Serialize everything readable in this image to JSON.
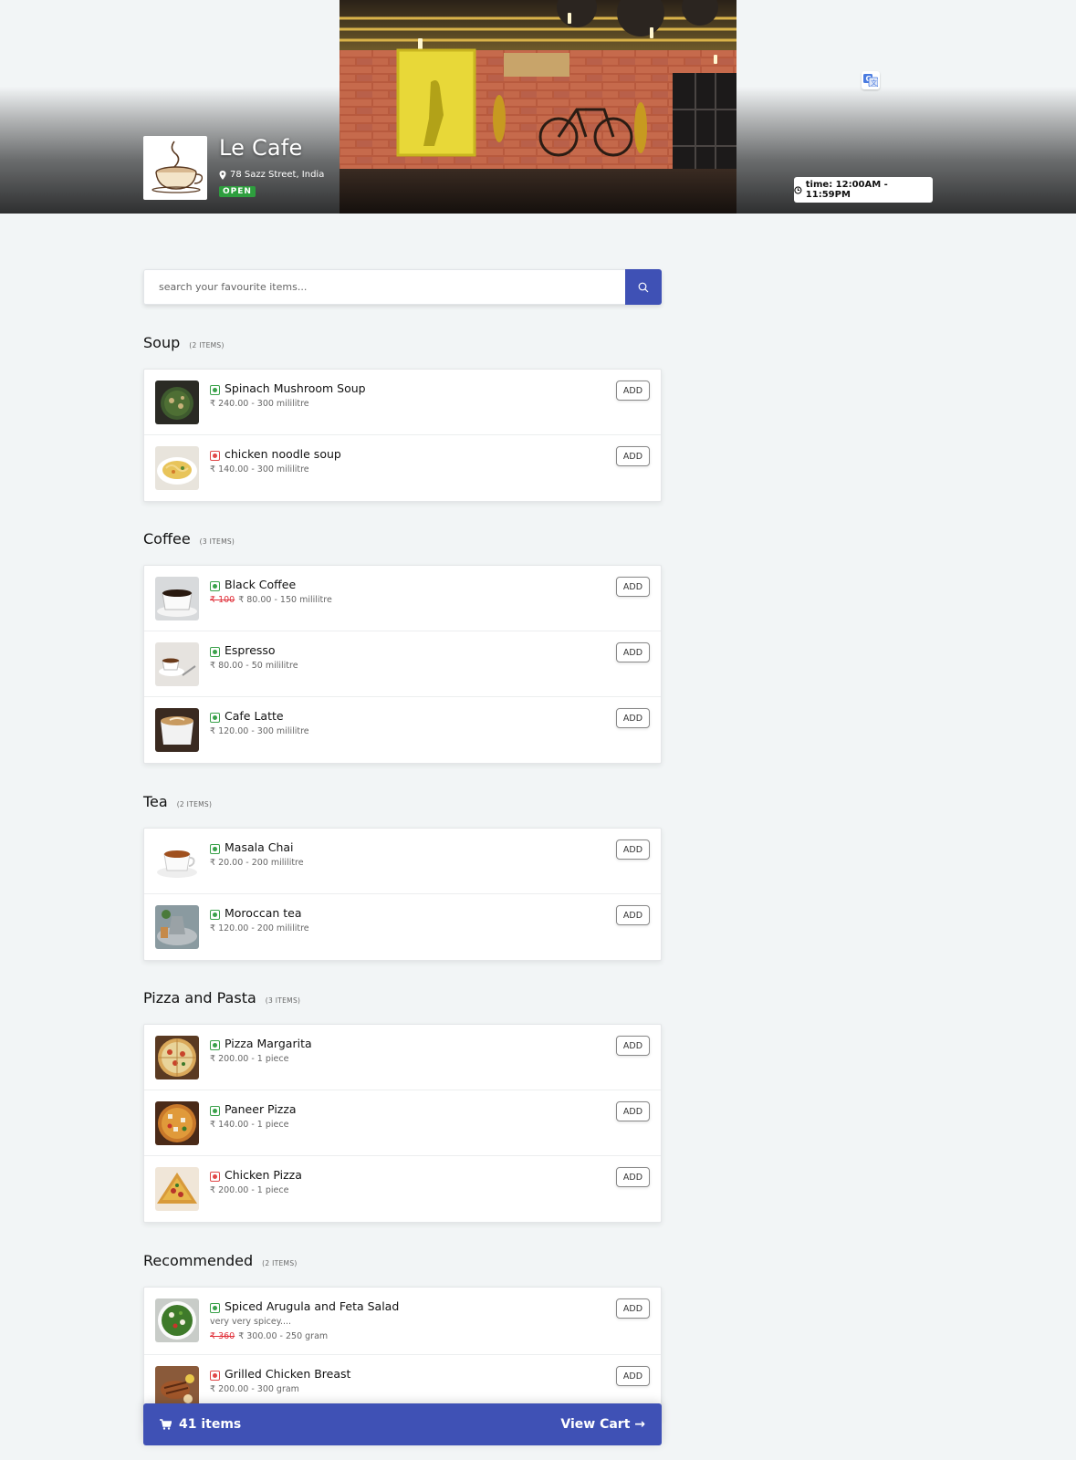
{
  "header": {
    "cafe_name": "Le Cafe",
    "address": "78 Sazz Street, India",
    "status": "OPEN",
    "time": "time: 12:00AM - 11:59PM",
    "logo_text": "LeCafe"
  },
  "search": {
    "placeholder": "search your favourite items..."
  },
  "categories": [
    {
      "title": "Soup",
      "count": "(2 ITEMS)",
      "items": [
        {
          "name": "Spinach Mushroom Soup",
          "type": "veg",
          "price": "₹ 240.00 - 300 mililitre",
          "add": "ADD"
        },
        {
          "name": "chicken noodle soup",
          "type": "nonveg",
          "price": "₹ 140.00 - 300 mililitre",
          "add": "ADD"
        }
      ]
    },
    {
      "title": "Coffee",
      "count": "(3 ITEMS)",
      "items": [
        {
          "name": "Black Coffee",
          "type": "veg",
          "old_price": "₹ 100",
          "price": "₹ 80.00 - 150 mililitre",
          "add": "ADD"
        },
        {
          "name": "Espresso",
          "type": "veg",
          "price": "₹ 80.00 - 50 mililitre",
          "add": "ADD"
        },
        {
          "name": "Cafe Latte",
          "type": "veg",
          "price": "₹ 120.00 - 300 mililitre",
          "add": "ADD"
        }
      ]
    },
    {
      "title": "Tea",
      "count": "(2 ITEMS)",
      "items": [
        {
          "name": "Masala Chai",
          "type": "veg",
          "price": "₹ 20.00 - 200 mililitre",
          "add": "ADD"
        },
        {
          "name": "Moroccan tea",
          "type": "veg",
          "price": "₹ 120.00 - 200 mililitre",
          "add": "ADD"
        }
      ]
    },
    {
      "title": "Pizza and Pasta",
      "count": "(3 ITEMS)",
      "items": [
        {
          "name": "Pizza Margarita",
          "type": "veg",
          "price": "₹ 200.00 - 1 piece",
          "add": "ADD"
        },
        {
          "name": "Paneer Pizza",
          "type": "veg",
          "price": "₹ 140.00 - 1 piece",
          "add": "ADD"
        },
        {
          "name": "Chicken Pizza",
          "type": "nonveg",
          "price": "₹ 200.00 - 1 piece",
          "add": "ADD"
        }
      ]
    },
    {
      "title": "Recommended",
      "count": "(2 ITEMS)",
      "items": [
        {
          "name": "Spiced Arugula and Feta Salad",
          "type": "veg",
          "desc": "very very spicey....",
          "old_price": "₹ 360",
          "price": "₹ 300.00 - 250 gram",
          "add": "ADD"
        },
        {
          "name": "Grilled Chicken Breast",
          "type": "nonveg",
          "price": "₹ 200.00 - 300 gram",
          "add": "ADD"
        }
      ]
    }
  ],
  "cart": {
    "items": "41 items",
    "view_cart": "View Cart →"
  },
  "colors": {
    "accent": "#3f51b5",
    "veg": "#3aa14a",
    "nonveg": "#e04848",
    "open": "#2e9e3e"
  }
}
